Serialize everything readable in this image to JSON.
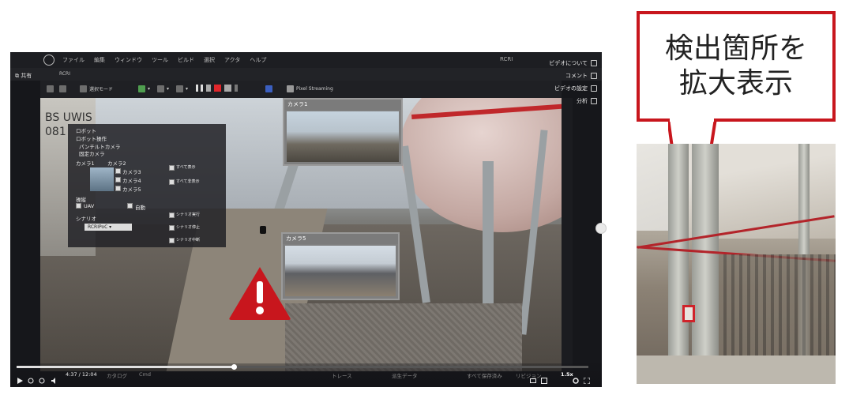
{
  "player": {
    "share_label": "共有",
    "menus": [
      "ファイル",
      "編集",
      "ウィンドウ",
      "ツール",
      "ビルド",
      "選択",
      "アクタ",
      "ヘルプ"
    ],
    "project_name": "RCRI",
    "tab_label": "RCRI",
    "toolbar": {
      "mode_label": "選択モード",
      "pixel_streaming_label": "Pixel Streaming"
    },
    "video_menu": {
      "about": "ビデオについて",
      "comments": "コメント",
      "settings": "ビデオの設定",
      "analysis": "分析"
    },
    "robot_panel": {
      "robot": "ロボット",
      "robot_ops": "ロボット操作",
      "pan_tilt": "パンチルトカメラ",
      "fixed_cam": "固定カメラ",
      "cam1": "カメラ1",
      "cam2": "カメラ2",
      "cam3": "カメラ3",
      "cam4": "カメラ4",
      "cam5": "カメラ5",
      "show_all": "すべて表示",
      "hide_all": "すべて非表示",
      "control": "操縦",
      "uav": "UAV",
      "auto": "自動",
      "scenario": "シナリオ",
      "scenario_value": "RCRIPoC",
      "scenario_run": "シナリオ実行",
      "scenario_stop": "シナリオ停止",
      "scenario_pause": "シナリオ中断"
    },
    "cam1_title": "カメラ1",
    "cam5_title": "カメラ5",
    "building_text": "BS UWIS\n081",
    "time_display": "4:37 / 12:04",
    "progress_fraction": 0.38,
    "speed_label": "1.5x",
    "bottom_labels": {
      "catalog": "カタログ",
      "cmd": "Cmd",
      "trace": "トレース",
      "source_data": "派生データ",
      "save_all": "すべて保存済み",
      "revision": "リビジョン"
    },
    "colors": {
      "warning": "#c8161d",
      "record": "#e0262b"
    }
  },
  "callout": {
    "line1": "検出箇所を",
    "line2": "拡大表示",
    "border_color": "#c8161d"
  }
}
